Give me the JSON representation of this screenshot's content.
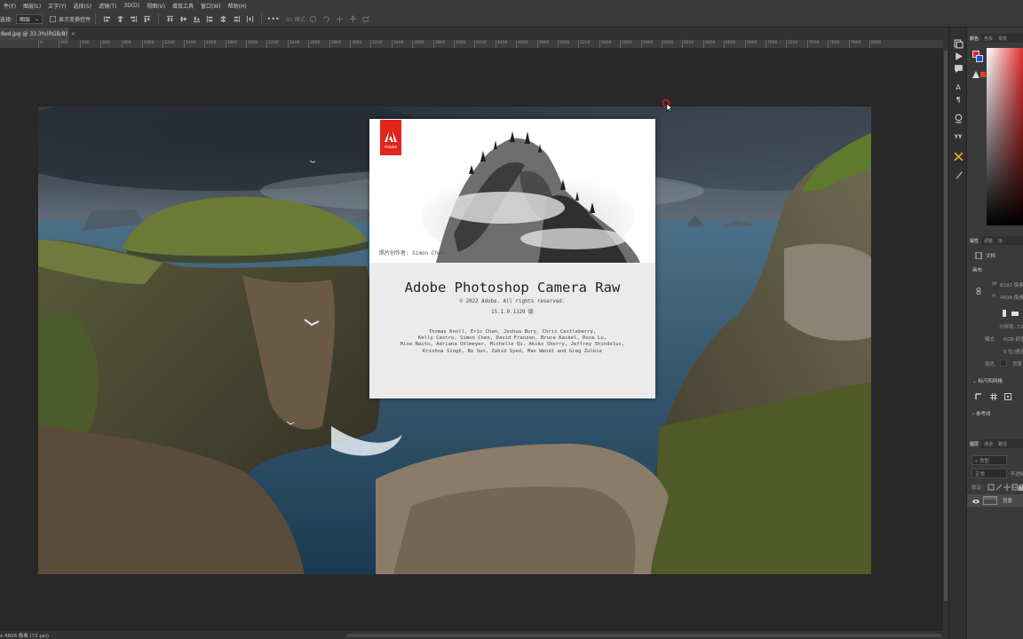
{
  "menubar": {
    "items": [
      "件(F)",
      "图层(L)",
      "文字(Y)",
      "选择(S)",
      "滤镜(T)",
      "3D(D)",
      "视图(V)",
      "增效工具",
      "窗口(W)",
      "帮助(H)"
    ]
  },
  "options": {
    "select_label": "选择:",
    "layer_dropdown": "图层",
    "show_transform_label": "显示变换控件",
    "mode_3d_label": "3D 模式:"
  },
  "document": {
    "tab_title": "8ed.jpg @ 33.3%(RGB/8)",
    "tab_close": "×",
    "status_text": "x 4608 像素 (72 ppi)"
  },
  "ruler": {
    "labels": [
      "0",
      "200",
      "400",
      "600",
      "800",
      "1000",
      "1200",
      "1400",
      "1600",
      "1800",
      "2000",
      "2200",
      "2400",
      "2600",
      "2800",
      "3000",
      "3200",
      "3400",
      "3600",
      "3800",
      "4000",
      "4200",
      "4400",
      "4600",
      "4800",
      "5000",
      "5200",
      "5400",
      "5600",
      "5800",
      "6000",
      "6200",
      "6400",
      "6600",
      "6800",
      "7000",
      "7200",
      "7400",
      "7600",
      "7800",
      "8000"
    ]
  },
  "splash": {
    "logo_text": "Adobe",
    "credit": "照片创作者: Simon Chen",
    "title": "Adobe Photoshop Camera Raw",
    "copyright": "© 2022 Adobe. All rights reserved.",
    "version": "15.1.0.1329 版",
    "names": [
      "Thomas Knoll, Eric Chan, Joshua Bury, Chris Castleberry,",
      "Kelly Castro, Simon Chen, David Franzen, Bruce Kaskel, Rose Lu,",
      "Hisa Naito, Adriana Ohlmeyer, Michelle Qi, Akiko Sherry, Jeffrey Shindelus,",
      "Krishna Singh, Bo Sun, Zahid Syed, Max Wendt and Greg Zulkie"
    ]
  },
  "right_tools": {
    "text_tool_glyph": "A",
    "para_glyph": "¶",
    "yy_glyph": "YY"
  },
  "panels": {
    "color_tabs": [
      "颜色",
      "色板",
      "渐变"
    ],
    "props_tabs": [
      "属性",
      "调整",
      "库"
    ],
    "doc_label": "文档",
    "canvas_section": "画布",
    "width_label": "W",
    "width_value": "8192 像素",
    "height_label": "H",
    "height_value": "4608 像素",
    "resolution_label": "分辨率: 72",
    "mode_label": "模式",
    "mode_value": "RGB 颜色",
    "depth_value": "8 位/通道",
    "fill_label": "填色",
    "fill_value": "背景",
    "rulers_section": "标尺和网格",
    "guides_section": "参考线",
    "layers_tabs": [
      "图层",
      "通道",
      "路径"
    ],
    "layer_filter": "类型",
    "blend_mode": "正常",
    "opacity_label": "不透明",
    "lock_label": "锁定:",
    "fill2_label": "填充",
    "layer_name": "背景"
  },
  "colors": {
    "accent_red": "#e1251b",
    "panel_bg": "#3a3a3a",
    "canvas_bg": "#282828"
  }
}
